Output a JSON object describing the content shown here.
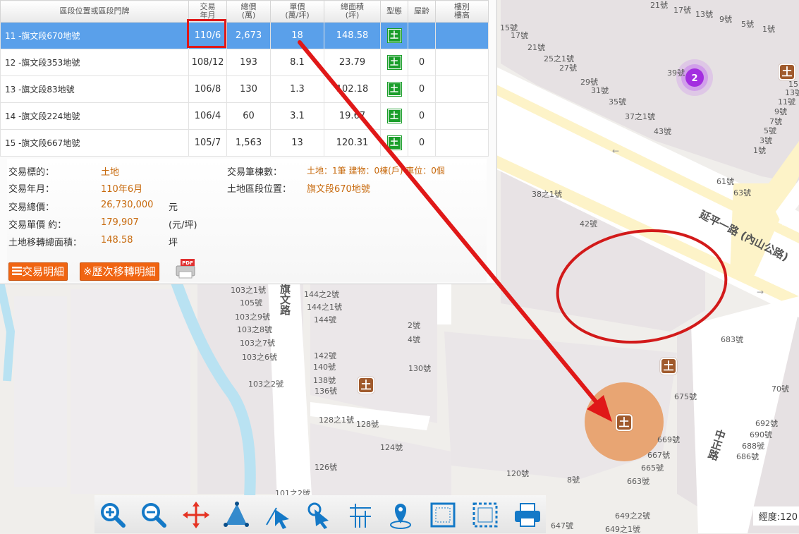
{
  "table": {
    "headers": {
      "location": "區段位置或區段門牌",
      "date_l1": "交易",
      "date_l2": "年月",
      "total_l1": "總價",
      "total_l2": "(萬)",
      "unit_l1": "單價",
      "unit_l2": "(萬/坪)",
      "area_l1": "總面積",
      "area_l2": "(坪)",
      "type": "型態",
      "age": "屋齡",
      "floor_l1": "樓別",
      "floor_l2": "樓高"
    },
    "rows": [
      {
        "location": "11 -旗文段670地號",
        "date": "110/6",
        "total": "2,673",
        "unit": "18",
        "area": "148.58",
        "type": "土",
        "age": "",
        "floor": ""
      },
      {
        "location": "12 -旗文段353地號",
        "date": "108/12",
        "total": "193",
        "unit": "8.1",
        "area": "23.79",
        "type": "土",
        "age": "0",
        "floor": ""
      },
      {
        "location": "13 -旗文段83地號",
        "date": "106/8",
        "total": "130",
        "unit": "1.3",
        "area": "102.18",
        "type": "土",
        "age": "0",
        "floor": ""
      },
      {
        "location": "14 -旗文段224地號",
        "date": "106/4",
        "total": "60",
        "unit": "3.1",
        "area": "19.67",
        "type": "土",
        "age": "0",
        "floor": ""
      },
      {
        "location": "15 -旗文段667地號",
        "date": "105/7",
        "total": "1,563",
        "unit": "13",
        "area": "120.31",
        "type": "土",
        "age": "0",
        "floor": ""
      }
    ]
  },
  "detail": {
    "target_label": "交易標的：",
    "target_value": "土地",
    "date_label": "交易年月：",
    "date_value": "110年6月",
    "total_label": "交易總價：",
    "total_value": "26,730,000",
    "total_unit": "元",
    "unit_label": "交易單價 約：",
    "unit_value": "179,907",
    "unit_unit": "(元/坪)",
    "area_label": "土地移轉總面積：",
    "area_value": "148.58",
    "area_unit": "坪",
    "count_label": "交易筆棟數：",
    "count_value": "土地：1筆 建物：0棟(戶) 車位：0個",
    "location_label": "土地區段位置：",
    "location_value": "旗文段670地號",
    "btn_detail": "交易明細",
    "btn_history": "※歷次移轉明細"
  },
  "map": {
    "roads": {
      "yanping": "延平一路 (內山公路)",
      "qiwen": "旗文路",
      "zhongzheng": "中正路"
    },
    "cluster_count": "2",
    "pin_symbol": "土",
    "labels": [
      "21號",
      "17號",
      "13號",
      "9號",
      "5號",
      "1號",
      "15號",
      "17號",
      "21號",
      "25之1號",
      "27號",
      "29號",
      "31號",
      "35號",
      "37之1號",
      "39號",
      "43號",
      "15",
      "13號",
      "11號",
      "9號",
      "7號",
      "5號",
      "3號",
      "1號",
      "61號",
      "63號",
      "38之1號",
      "42號",
      "683號",
      "70號",
      "675號",
      "669號",
      "667號",
      "665號",
      "663號",
      "692號",
      "690號",
      "688號",
      "686號",
      "120號",
      "8號",
      "649之2號",
      "649之1號",
      "647號",
      "126號",
      "124號",
      "128之1號",
      "128號",
      "130號",
      "2號",
      "4號",
      "142號",
      "140號",
      "138號",
      "136號",
      "144之2號",
      "144之1號",
      "144號",
      "105號",
      "103之9號",
      "103之8號",
      "103之7號",
      "103之6號",
      "103之2號",
      "101之2號",
      "103之1號"
    ]
  },
  "coord_text": "經度:120",
  "icons": [
    "zoom-in-icon",
    "zoom-out-icon",
    "pan-icon",
    "measure-area-icon",
    "select-arrow-icon",
    "pan-hand-icon",
    "street-grid-icon",
    "locate-pin-icon",
    "select-box-icon",
    "select-box-dashed-icon",
    "print-icon",
    "pdf-icon",
    "list-icon",
    "cluster-icon"
  ]
}
